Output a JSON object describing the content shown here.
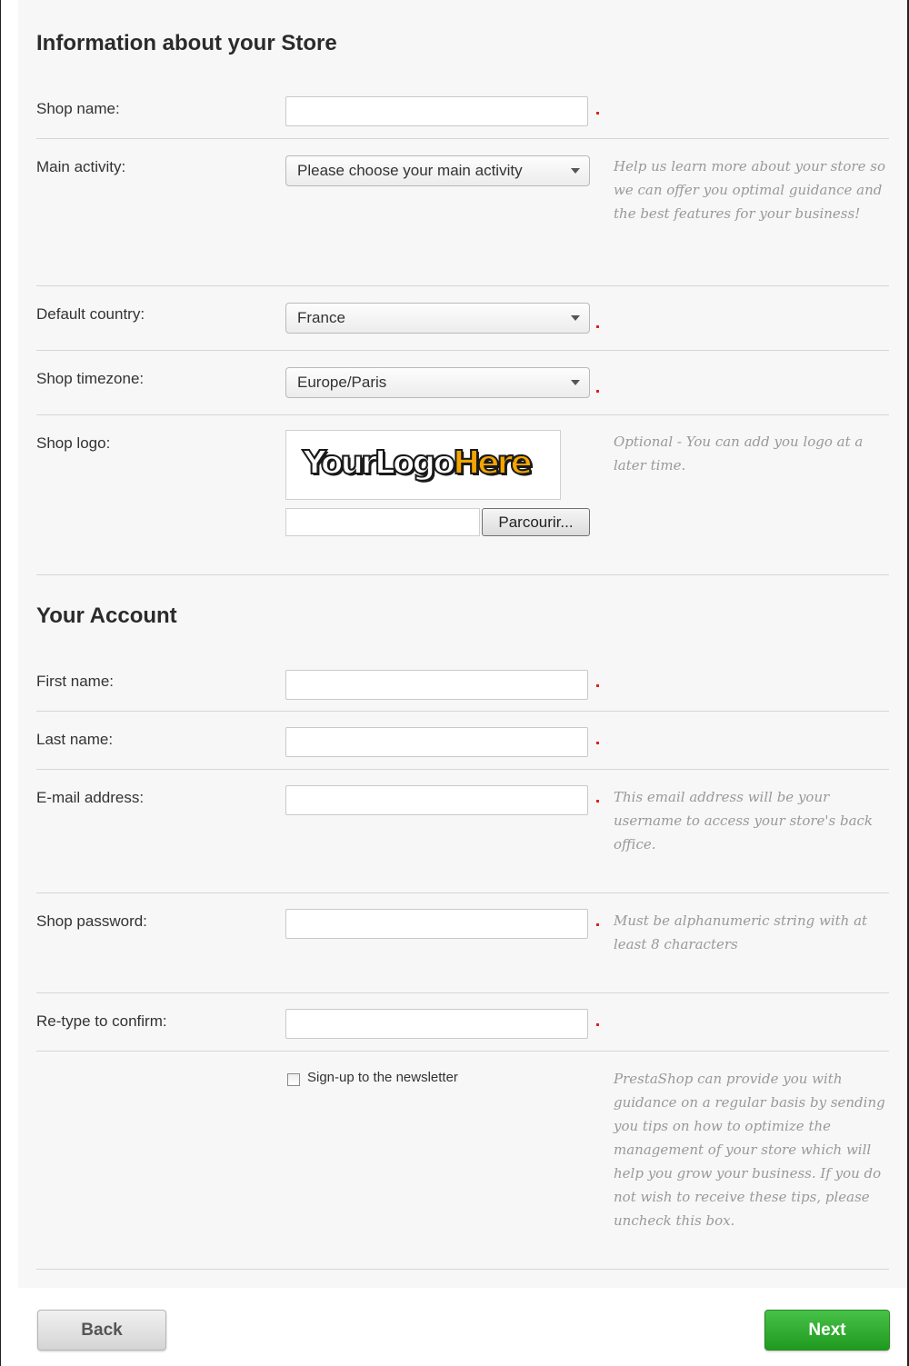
{
  "store_section": {
    "title": "Information about your Store",
    "shop_name_label": "Shop name:",
    "main_activity_label": "Main activity:",
    "main_activity_value": "Please choose your main activity",
    "main_activity_hint": "Help us learn more about your store so we can offer you optimal guidance and the best features for your business!",
    "default_country_label": "Default country:",
    "default_country_value": "France",
    "timezone_label": "Shop timezone:",
    "timezone_value": "Europe/Paris",
    "logo_label": "Shop logo:",
    "logo_text_part1": "YourLogo",
    "logo_text_part2": "Here",
    "browse_button": "Parcourir...",
    "logo_hint": "Optional - You can add you logo at a later time."
  },
  "account_section": {
    "title": "Your Account",
    "first_name_label": "First name:",
    "last_name_label": "Last name:",
    "email_label": "E-mail address:",
    "email_hint": "This email address will be your username to access your store's back office.",
    "password_label": "Shop password:",
    "password_hint": "Must be alphanumeric string with at least 8 characters",
    "confirm_label": "Re-type to confirm:",
    "newsletter_label": "Sign-up to the newsletter",
    "newsletter_hint": "PrestaShop can provide you with guidance on a regular basis by sending you tips on how to optimize the management of your store which will help you grow your business. If you do not wish to receive these tips, please uncheck this box."
  },
  "footer": {
    "back_button": "Back",
    "next_button": "Next"
  },
  "colors": {
    "required_marker": "#dd2222",
    "next_button": "#2ea82e"
  }
}
